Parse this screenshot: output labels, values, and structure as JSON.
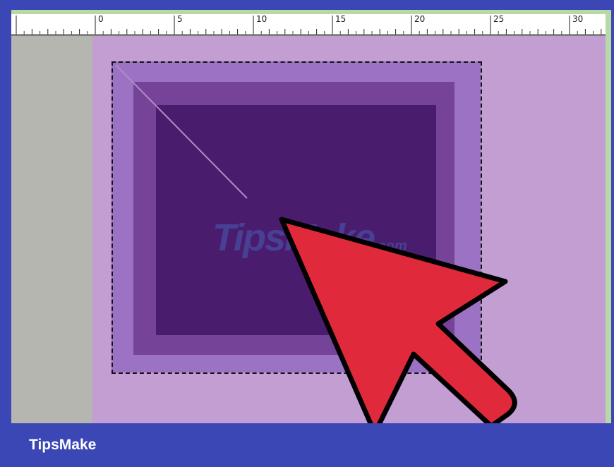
{
  "ruler": {
    "labels": [
      "0",
      "5",
      "10",
      "15",
      "20",
      "25",
      "30"
    ]
  },
  "watermark": {
    "text": "TipsMake",
    "suffix": ".com"
  },
  "footer": {
    "brand": "TipsMake"
  },
  "colors": {
    "frame": "#3a47b4",
    "canvas": "#c29ed2",
    "outer_layer": "#9b72c4",
    "middle_layer": "#754499",
    "inner_layer": "#4a1c6e",
    "cursor_fill": "#e02a3c",
    "gutter": "#b6b6b0"
  },
  "icons": {
    "cursor": "mouse-pointer-arrow-icon"
  }
}
